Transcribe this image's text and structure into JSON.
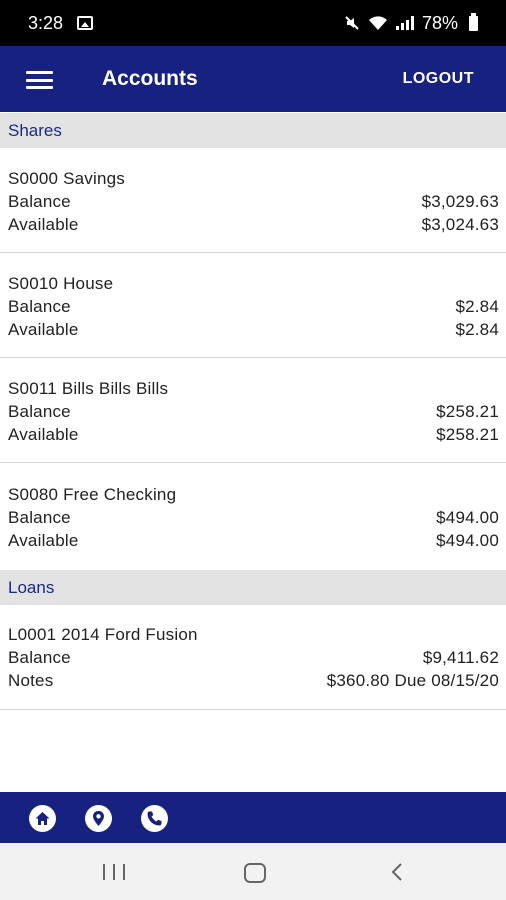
{
  "status_bar": {
    "time": "3:28",
    "battery": "78%"
  },
  "app_bar": {
    "title": "Accounts",
    "logout_label": "LOGOUT"
  },
  "sections": [
    {
      "title": "Shares"
    },
    {
      "title": "Loans"
    }
  ],
  "shares": [
    {
      "name": "S0000 Savings",
      "row1_label": "Balance",
      "row1_value": "$3,029.63",
      "row2_label": "Available",
      "row2_value": "$3,024.63"
    },
    {
      "name": "S0010 House",
      "row1_label": "Balance",
      "row1_value": "$2.84",
      "row2_label": "Available",
      "row2_value": "$2.84"
    },
    {
      "name": "S0011 Bills Bills Bills",
      "row1_label": "Balance",
      "row1_value": "$258.21",
      "row2_label": "Available",
      "row2_value": "$258.21"
    },
    {
      "name": "S0080 Free Checking",
      "row1_label": "Balance",
      "row1_value": "$494.00",
      "row2_label": "Available",
      "row2_value": "$494.00"
    }
  ],
  "loans": [
    {
      "name": "L0001 2014 Ford Fusion",
      "row1_label": "Balance",
      "row1_value": "$9,411.62",
      "row2_label": "Notes",
      "row2_value": "$360.80 Due 08/15/20"
    }
  ],
  "bottom_bar": {
    "icons": [
      "home-icon",
      "location-pin-icon",
      "phone-icon"
    ]
  },
  "colors": {
    "primary": "#17217f",
    "section_bg": "#e3e3e3",
    "section_text": "#1c2a85"
  }
}
